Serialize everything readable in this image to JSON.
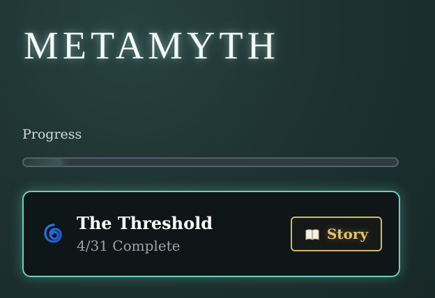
{
  "app": {
    "title": "METAMYTH"
  },
  "progress": {
    "label": "Progress",
    "value_fraction": 0.1
  },
  "chapter": {
    "icon": "spiral-icon",
    "title": "The Threshold",
    "status": "4/31 Complete",
    "story_button_label": "Story",
    "story_button_icon": "book-icon"
  },
  "colors": {
    "title_glow": "#cffff5",
    "card_border": "#6ad0c0",
    "button_border": "#d9b56a",
    "button_text": "#e9c26c"
  }
}
